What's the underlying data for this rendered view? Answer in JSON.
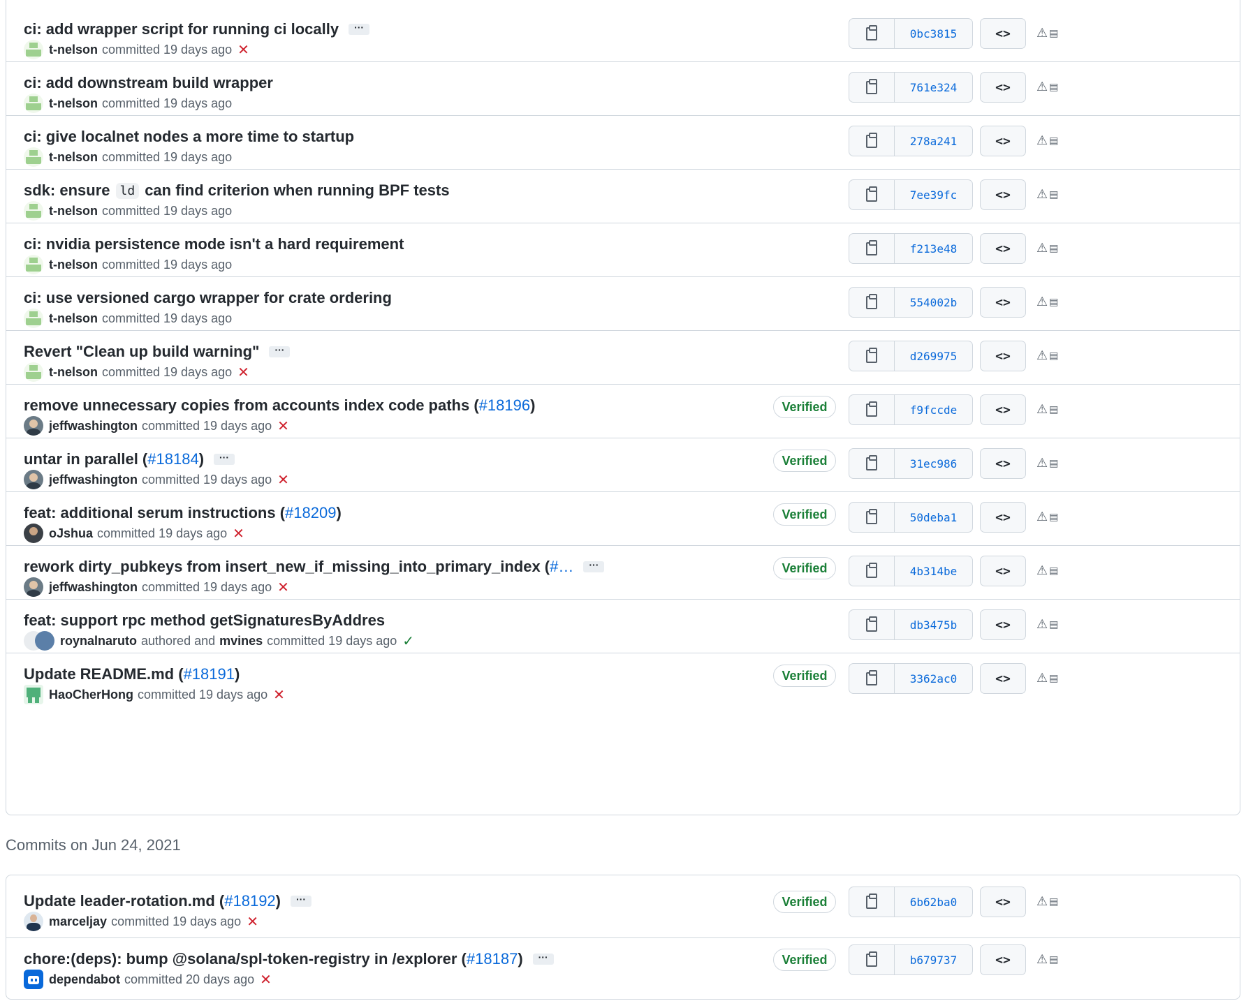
{
  "groups": [
    {
      "rows": [
        {
          "title": "ci: add wrapper script for running ci locally",
          "ellipsis": "···",
          "author": "t-nelson",
          "meta": "committed 19 days ago",
          "status": "✕",
          "sha": "0bc3815"
        },
        {
          "title": "ci: add downstream build wrapper",
          "author": "t-nelson",
          "meta": "committed 19 days ago",
          "sha": "761e324"
        },
        {
          "title": "ci: give localnet nodes a more time to startup",
          "author": "t-nelson",
          "meta": "committed 19 days ago",
          "sha": "278a241"
        },
        {
          "title_a": "sdk: ensure",
          "code": "ld",
          "title_b": "can find criterion when running BPF tests",
          "author": "t-nelson",
          "meta": "committed 19 days ago",
          "sha": "7ee39fc"
        },
        {
          "title": "ci: nvidia persistence mode isn't a hard requirement",
          "author": "t-nelson",
          "meta": "committed 19 days ago",
          "sha": "f213e48"
        },
        {
          "title": "ci: use versioned cargo wrapper for crate ordering",
          "author": "t-nelson",
          "meta": "committed 19 days ago",
          "sha": "554002b"
        },
        {
          "title": "Revert \"Clean up build warning\"",
          "ellipsis": "···",
          "author": "t-nelson",
          "meta": "committed 19 days ago",
          "status": "✕",
          "sha": "d269975"
        },
        {
          "title": "remove unnecessary copies from accounts index code paths (",
          "pr": "#18196",
          "close": ")",
          "author": "jeffwashington",
          "meta": "committed 19 days ago",
          "status": "✕",
          "verified": "Verified",
          "sha": "f9fccde"
        },
        {
          "title": "untar in parallel (",
          "pr": "#18184",
          "close": ")",
          "ellipsis": "···",
          "author": "jeffwashington",
          "meta": "committed 19 days ago",
          "status": "✕",
          "verified": "Verified",
          "sha": "31ec986"
        },
        {
          "title": "feat: additional serum instructions (",
          "pr": "#18209",
          "close": ")",
          "author": "oJshua",
          "meta": "committed 19 days ago",
          "status": "✕",
          "verified": "Verified",
          "sha": "50deba1"
        },
        {
          "title": "rework dirty_pubkeys from insert_new_if_missing_into_primary_index (",
          "pr": "#…",
          "ellipsis": "···",
          "author": "jeffwashington",
          "meta": "committed 19 days ago",
          "status": "✕",
          "verified": "Verified",
          "sha": "4b314be"
        },
        {
          "title": "feat: support rpc method getSignaturesByAddres",
          "author": "roynalnaruto",
          "meta_mid": "authored and",
          "author2": "mvines",
          "meta": "committed 19 days ago",
          "status": "✓",
          "sha": "db3475b"
        },
        {
          "title": "Update README.md (",
          "pr": "#18191",
          "close": ")",
          "author": "HaoCherHong",
          "meta": "committed 19 days ago",
          "status": "✕",
          "verified": "Verified",
          "sha": "3362ac0"
        }
      ]
    },
    {
      "header": "Commits on Jun 24, 2021",
      "rows": [
        {
          "title": "Update leader-rotation.md (",
          "pr": "#18192",
          "close": ")",
          "ellipsis": "···",
          "author": "marceljay",
          "meta": "committed 19 days ago",
          "status": "✕",
          "verified": "Verified",
          "sha": "6b62ba0"
        },
        {
          "title": "chore:(deps): bump @solana/spl-token-registry in /explorer (",
          "pr": "#18187",
          "close": ")",
          "ellipsis": "···",
          "author": "dependabot",
          "meta": "committed 20 days ago",
          "status": "✕",
          "verified": "Verified",
          "sha": "b679737"
        }
      ]
    }
  ],
  "labels": {
    "browse": "<>",
    "ext_tri": "⚠",
    "ext_sq": "▤"
  },
  "icons": {
    "copy": "clipboard-icon",
    "browse": "code-icon",
    "extension": "extension-icon",
    "fail": "x-icon",
    "pass": "check-icon"
  },
  "colors": {
    "link": "#0969da",
    "fail": "#cf222e",
    "pass": "#1a7f37",
    "border": "#d0d7de"
  }
}
